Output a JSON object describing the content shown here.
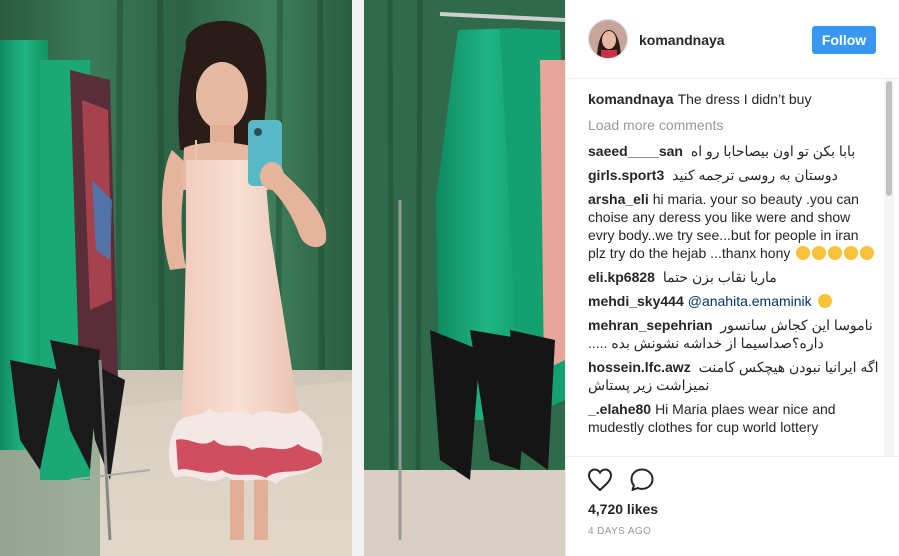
{
  "post": {
    "alt": "Woman taking a mirror selfie in a pale pink slip dress with red feather hem, in a fitting room with green velvet curtains and green dresses on racks"
  },
  "header": {
    "username": "komandnaya",
    "follow_label": "Follow"
  },
  "caption": {
    "username": "komandnaya",
    "text": "The dress I didn’t buy"
  },
  "load_more_label": "Load more comments",
  "comments": [
    {
      "username": "saeed____san",
      "text": "بابا بکن تو اون بیصاحابا رو اه",
      "rtl": true
    },
    {
      "username": "girls.sport3",
      "text": "دوستان به روسی ترجمه کنید",
      "rtl": true
    },
    {
      "username": "arsha_eli",
      "text": "hi maria. your so beauty .you can choise any deress you like were and show evry body..we try see...but for people in iran plz try do the hejab ...thanx hony",
      "rtl": false
    },
    {
      "username": "eli.kp6828",
      "text": "ماریا نقاب بزن حتما",
      "rtl": true
    },
    {
      "username": "mehdi_sky444",
      "text": "@anahita.emaminik",
      "rtl": false
    },
    {
      "username": "mehran_sepehrian",
      "text": "ناموسا این کجاش سانسور داره؟صداسیما از خداشه نشونش بده .....",
      "rtl": true
    },
    {
      "username": "hossein.lfc.awz",
      "text": "اگه ایرانیا نبودن هیچکس کامنت نمیزاشت زیر پستاش",
      "rtl": true
    },
    {
      "username": "_.elahe80",
      "text": "Hi Maria plaes wear nice and mudestly clothes for cup world lottery",
      "rtl": false
    }
  ],
  "emoji": {
    "arsha_eli": [
      "blush",
      "blush",
      "heart-eyes",
      "heart-eyes",
      "heart-eyes"
    ],
    "mehdi_sky444": [
      "laugh"
    ]
  },
  "actions": {
    "likes": "4,720 likes",
    "time_ago": "4 DAYS AGO"
  },
  "colors": {
    "follow_button": "#3897f0",
    "curtain_green": "#2f6b4a",
    "dress_green": "#18a878",
    "dress_pink": "#f3d3c4",
    "feather_red": "#c83248",
    "phone_blue": "#58b8c8"
  }
}
